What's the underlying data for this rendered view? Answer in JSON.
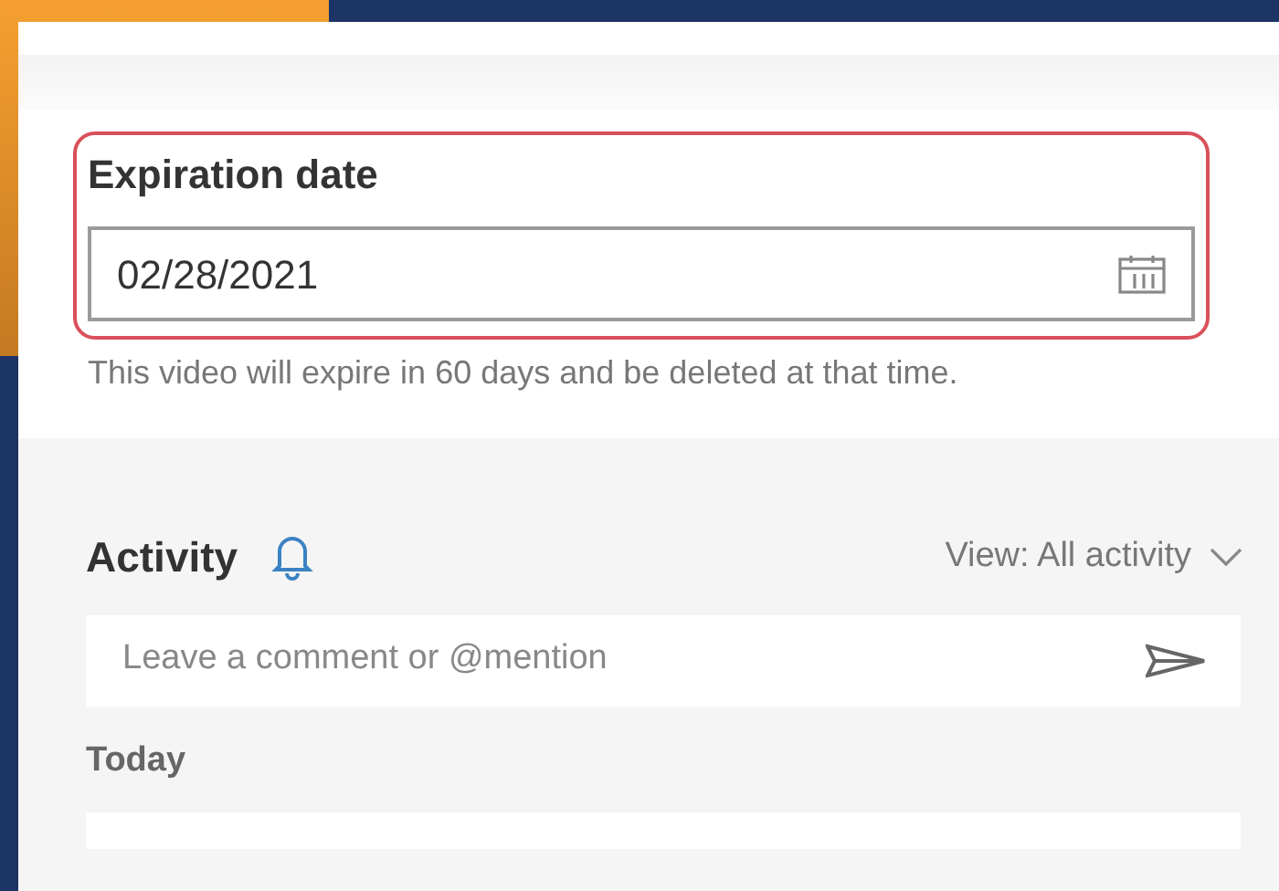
{
  "expiration": {
    "label": "Expiration date",
    "value": "02/28/2021",
    "highlighted": true,
    "helper": "This video will expire in 60 days and be deleted at that time."
  },
  "activity": {
    "title": "Activity",
    "view": "View: All activity",
    "comment": {
      "placeholder": "Leave a comment or @mention"
    },
    "group": "Today"
  }
}
